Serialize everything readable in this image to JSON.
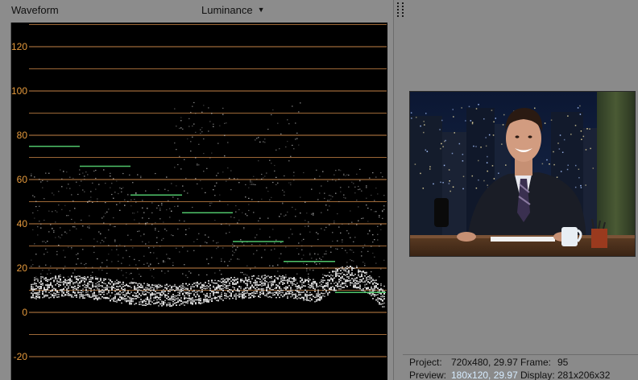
{
  "scope": {
    "title": "Waveform",
    "mode_label": "Luminance",
    "mode_icon": "chevron-down-icon",
    "y_ticks": [
      "120",
      "100",
      "80",
      "60",
      "40",
      "20",
      "0",
      "-20"
    ],
    "tick_values": [
      120,
      100,
      80,
      60,
      40,
      20,
      0,
      -20
    ],
    "colors": {
      "background": "#000000",
      "gridline": "#d08a4a",
      "tick_label": "#e69a3c",
      "trace": "#e8e8e8",
      "marker": "#4fc46a"
    }
  },
  "preview": {
    "status": {
      "project_label": "Project:",
      "project_value": "720x480, 29.97",
      "frame_label": "Frame:",
      "frame_value": "95",
      "preview_label": "Preview:",
      "preview_value": "180x120, 29.97",
      "display_label": "Display:",
      "display_value": "281x206x32"
    }
  }
}
